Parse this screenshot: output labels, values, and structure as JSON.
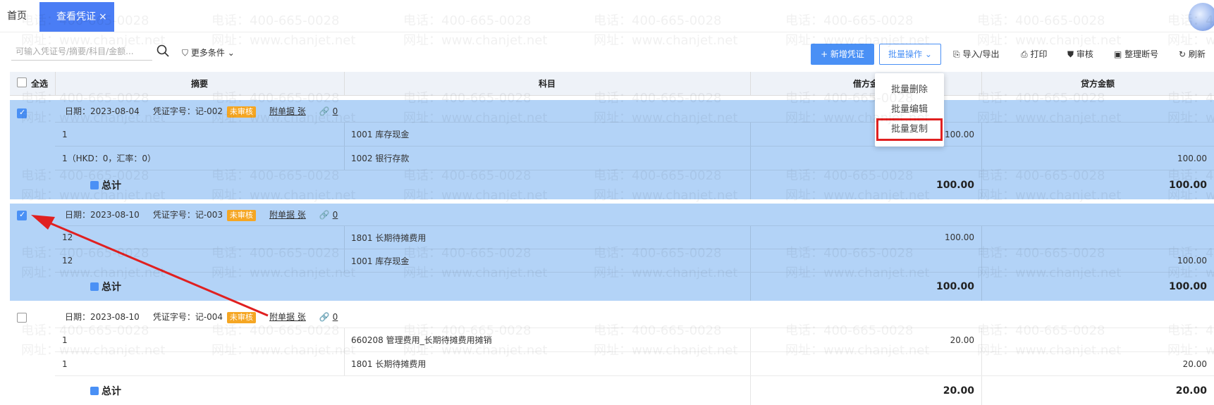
{
  "tabs": {
    "home": "首页",
    "active": "查看凭证",
    "close": "×"
  },
  "toolbar": {
    "search_placeholder": "可输入凭证号/摘要/科目/金额...",
    "more_filters": "更多条件",
    "add_voucher": "+ 新增凭证",
    "batch_ops": "批量操作",
    "import_export": "导入/导出",
    "print": "打印",
    "audit": "审核",
    "renumber": "整理断号",
    "refresh": "刷新"
  },
  "dropdown": {
    "items": [
      "批量删除",
      "批量编辑",
      "批量复制"
    ]
  },
  "table": {
    "select_all": "全选",
    "col_summary": "摘要",
    "col_account": "科目",
    "col_debit": "借方金",
    "col_credit": "贷方金额"
  },
  "vouchers": [
    {
      "checked": true,
      "date": "日期：2023-08-04",
      "number": "凭证字号：记-002",
      "status": "未审核",
      "attach": "附单据 张",
      "link_count": "0",
      "lines": [
        {
          "summary": "1",
          "account": "1001 库存现金",
          "debit": "100.00",
          "credit": ""
        },
        {
          "summary": "1（HKD：0，汇率：0）",
          "account": "1002 银行存款",
          "debit": "",
          "credit": "100.00"
        }
      ],
      "total_label": "总计",
      "total_debit": "100.00",
      "total_credit": "100.00"
    },
    {
      "checked": true,
      "date": "日期：2023-08-10",
      "number": "凭证字号：记-003",
      "status": "未审核",
      "attach": "附单据 张",
      "link_count": "0",
      "lines": [
        {
          "summary": "12",
          "account": "1801 长期待摊费用",
          "debit": "100.00",
          "credit": ""
        },
        {
          "summary": "12",
          "account": "1001 库存现金",
          "debit": "",
          "credit": "100.00"
        }
      ],
      "total_label": "总计",
      "total_debit": "100.00",
      "total_credit": "100.00"
    },
    {
      "checked": false,
      "date": "日期：2023-08-10",
      "number": "凭证字号：记-004",
      "status": "未审核",
      "attach": "附单据 张",
      "link_count": "0",
      "lines": [
        {
          "summary": "1",
          "account": "660208 管理费用_长期待摊费用摊销",
          "debit": "20.00",
          "credit": ""
        },
        {
          "summary": "1",
          "account": "1801 长期待摊费用",
          "debit": "",
          "credit": "20.00"
        }
      ],
      "total_label": "总计",
      "total_debit": "20.00",
      "total_credit": "20.00"
    }
  ],
  "watermark": {
    "phone": "电话：400-665-0028",
    "site": "网址：www.chanjet.net"
  },
  "colors": {
    "accent": "#4a90f5",
    "selected_row": "#b3d3f7",
    "badge": "#f5a623",
    "annotation": "#e02020"
  }
}
